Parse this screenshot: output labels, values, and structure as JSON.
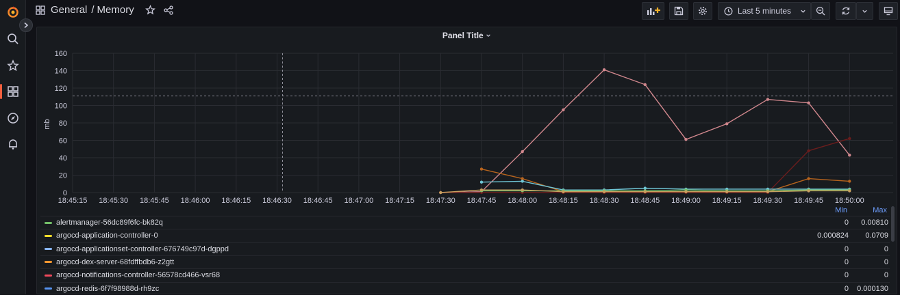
{
  "breadcrumb": {
    "folder": "General",
    "separator": "/",
    "dashboard": "Memory"
  },
  "toolbar": {
    "time_range": "Last 5 minutes"
  },
  "panel": {
    "title": "Panel Title"
  },
  "legend": {
    "min_header": "Min",
    "max_header": "Max",
    "rows": [
      {
        "name": "alertmanager-56dc89f6fc-bk82q",
        "color": "#73bf69",
        "min": "0",
        "max": "0.00810"
      },
      {
        "name": "argocd-application-controller-0",
        "color": "#fade2a",
        "min": "0.000824",
        "max": "0.0709"
      },
      {
        "name": "argocd-applicationset-controller-676749c97d-dgppd",
        "color": "#8ab8ff",
        "min": "0",
        "max": "0"
      },
      {
        "name": "argocd-dex-server-68fdffbdb6-z2gtt",
        "color": "#ff9830",
        "min": "0",
        "max": "0"
      },
      {
        "name": "argocd-notifications-controller-56578cd466-vsr68",
        "color": "#f2495c",
        "min": "0",
        "max": "0"
      },
      {
        "name": "argocd-redis-6f7f98988d-rh9zc",
        "color": "#5794f2",
        "min": "0",
        "max": "0.000130"
      }
    ]
  },
  "chart_data": {
    "type": "line",
    "ylabel": "mb",
    "ylim": [
      0,
      160
    ],
    "yticks": [
      0,
      20,
      40,
      60,
      80,
      100,
      120,
      140,
      160
    ],
    "xticks": [
      "18:45:15",
      "18:45:30",
      "18:45:45",
      "18:46:00",
      "18:46:15",
      "18:46:30",
      "18:46:45",
      "18:47:00",
      "18:47:15",
      "18:47:30",
      "18:47:45",
      "18:48:00",
      "18:48:15",
      "18:48:30",
      "18:48:45",
      "18:49:00",
      "18:49:15",
      "18:49:30",
      "18:49:45",
      "18:50:00"
    ],
    "threshold": 111,
    "series": [
      {
        "color": "#d0878d",
        "x": [
          "18:47:30",
          "18:47:45",
          "18:48:00",
          "18:48:15",
          "18:48:30",
          "18:48:45",
          "18:49:00",
          "18:49:15",
          "18:49:30",
          "18:49:45",
          "18:50:00"
        ],
        "values": [
          0,
          1,
          47,
          95,
          141,
          124,
          61,
          79,
          107,
          103,
          43
        ]
      },
      {
        "color": "#6b1d1d",
        "x": [
          "18:47:30",
          "18:47:45",
          "18:48:00",
          "18:48:15",
          "18:48:30",
          "18:48:45",
          "18:49:00",
          "18:49:15",
          "18:49:30",
          "18:49:45",
          "18:50:00"
        ],
        "values": [
          0,
          0,
          0,
          0,
          0,
          0,
          0,
          0,
          0,
          48,
          62
        ]
      },
      {
        "color": "#b8641d",
        "x": [
          "18:47:45",
          "18:48:00",
          "18:48:15",
          "18:48:30",
          "18:48:45",
          "18:49:00",
          "18:49:15",
          "18:49:30",
          "18:49:45",
          "18:50:00"
        ],
        "values": [
          27,
          16,
          1,
          1,
          1,
          1,
          1,
          1,
          16,
          13
        ]
      },
      {
        "color": "#6fc6d6",
        "x": [
          "18:47:45",
          "18:48:00",
          "18:48:15",
          "18:48:30",
          "18:48:45",
          "18:49:00",
          "18:49:15",
          "18:49:30",
          "18:49:45",
          "18:50:00"
        ],
        "values": [
          12,
          13,
          3,
          3,
          5,
          4,
          4,
          4,
          4,
          4
        ]
      },
      {
        "color": "#73bf69",
        "x": [
          "18:47:45",
          "18:48:00",
          "18:48:15",
          "18:48:30",
          "18:48:45",
          "18:49:00",
          "18:49:15",
          "18:49:30",
          "18:49:45",
          "18:50:00"
        ],
        "values": [
          2,
          2,
          2,
          2,
          2,
          3,
          2,
          2,
          3,
          3
        ]
      },
      {
        "color": "#c8a060",
        "x": [
          "18:47:30",
          "18:47:45",
          "18:48:00",
          "18:48:15",
          "18:48:30",
          "18:48:45",
          "18:49:00",
          "18:49:15",
          "18:49:30",
          "18:49:45",
          "18:50:00"
        ],
        "values": [
          0,
          3,
          3,
          1,
          1,
          1,
          1,
          1,
          1,
          2,
          2
        ]
      }
    ]
  }
}
